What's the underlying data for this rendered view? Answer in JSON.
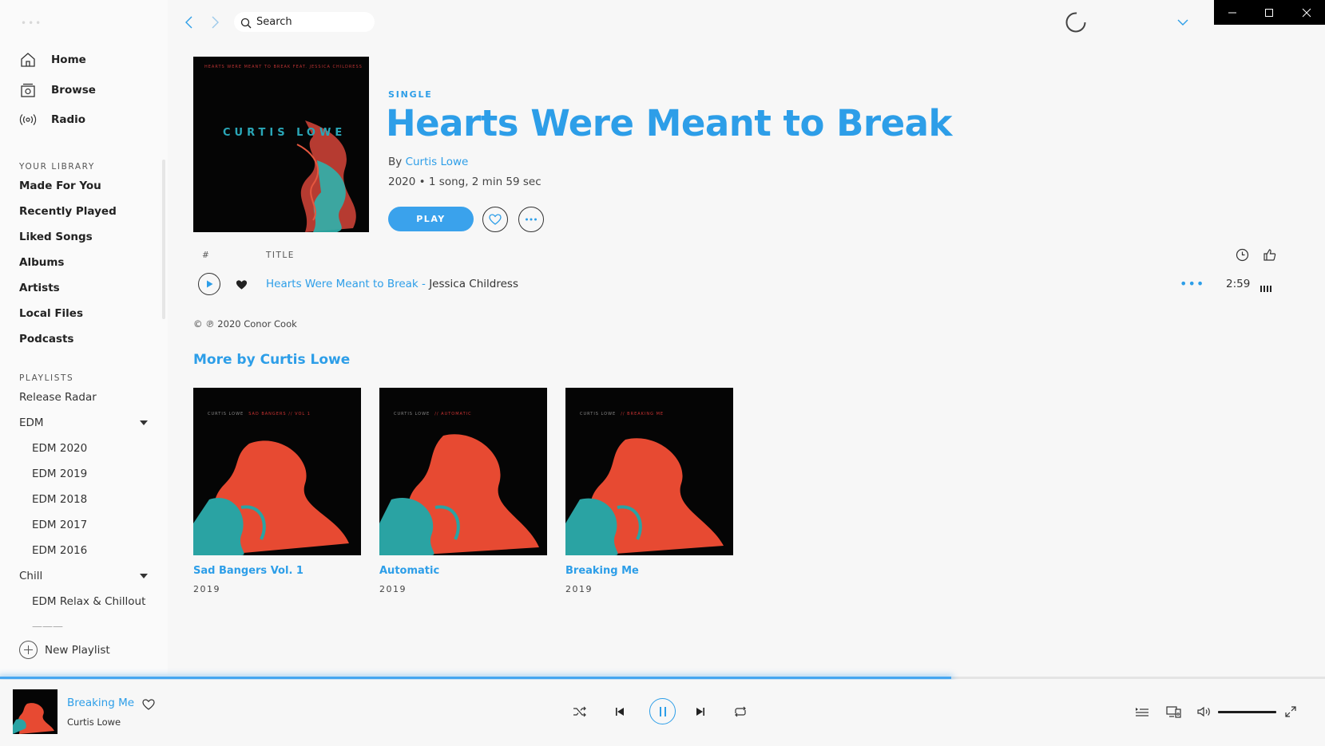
{
  "nav": {
    "items": [
      {
        "label": "Home",
        "icon": "home-icon"
      },
      {
        "label": "Browse",
        "icon": "browse-icon"
      },
      {
        "label": "Radio",
        "icon": "radio-icon"
      }
    ]
  },
  "library": {
    "title": "YOUR LIBRARY",
    "items": [
      "Made For You",
      "Recently Played",
      "Liked Songs",
      "Albums",
      "Artists",
      "Local Files",
      "Podcasts"
    ]
  },
  "playlists": {
    "title": "PLAYLISTS",
    "items": [
      {
        "label": "Release Radar"
      },
      {
        "label": "EDM"
      },
      {
        "label": "EDM 2020"
      },
      {
        "label": "EDM 2019"
      },
      {
        "label": "EDM 2018"
      },
      {
        "label": "EDM 2017"
      },
      {
        "label": "EDM 2016"
      },
      {
        "label": "Chill"
      },
      {
        "label": "EDM Relax & Chillout"
      }
    ],
    "new_playlist": "New Playlist"
  },
  "search": {
    "placeholder": "Search"
  },
  "album": {
    "cover_artist": "CURTIS LOWE",
    "cover_top": "HEARTS WERE MEANT TO BREAK  FEAT. JESSICA CHILDRESS",
    "type": "SINGLE",
    "title": "Hearts Were Meant to Break",
    "by_prefix": "By",
    "artist": "Curtis Lowe",
    "meta": "2020 • 1 song, 2 min 59 sec",
    "play_label": "PLAY"
  },
  "tracks": {
    "headers": {
      "number": "#",
      "title": "TITLE"
    },
    "rows": [
      {
        "title": "Hearts Were Meant to Break",
        "separator": " - ",
        "artist": "Jessica Childress",
        "duration": "2:59",
        "more": "•••"
      }
    ]
  },
  "copyright": "© ℗ 2020 Conor Cook",
  "more_by": {
    "title": "More by Curtis Lowe",
    "cards": [
      {
        "title": "Sad Bangers Vol. 1",
        "year": "2019",
        "art_label": "CURTIS LOWE",
        "art_sub": "SAD BANGERS // VOL 1"
      },
      {
        "title": "Automatic",
        "year": "2019",
        "art_label": "CURTIS LOWE",
        "art_sub": "//    AUTOMATIC"
      },
      {
        "title": "Breaking Me",
        "year": "2019",
        "art_label": "CURTIS LOWE",
        "art_sub": "//    BREAKING ME"
      }
    ]
  },
  "now_playing": {
    "title": "Breaking Me",
    "artist": "Curtis Lowe",
    "progress": 0.718,
    "volume": 1.0
  },
  "colors": {
    "accent": "#2d9ee8",
    "play_button": "#3aa2ec",
    "window_controls": "#000000"
  }
}
